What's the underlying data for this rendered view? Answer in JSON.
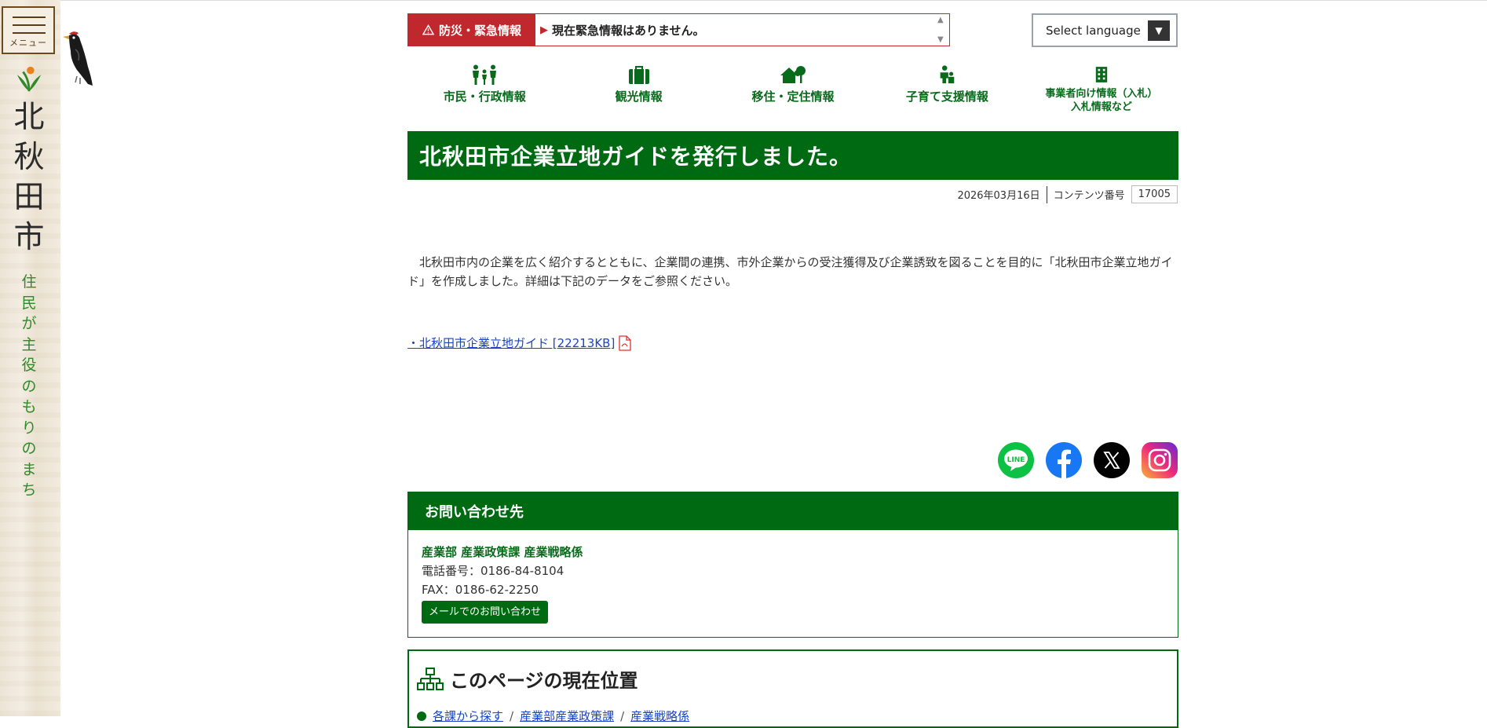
{
  "sidebar": {
    "menu_label": "メニュー",
    "city_chars": [
      "北",
      "秋",
      "田",
      "市"
    ],
    "slogan_chars": [
      "住",
      "民",
      "が",
      "主",
      "役",
      "の",
      "も",
      "り",
      "の",
      "ま",
      "ち"
    ]
  },
  "emergency": {
    "label": "防災・緊急情報",
    "message": "現在緊急情報はありません。"
  },
  "language": {
    "label": "Select language"
  },
  "nav": {
    "citizen": "市民・行政情報",
    "tourism": "観光情報",
    "migration": "移住・定住情報",
    "childcare": "子育て支援情報",
    "business_line1": "事業者向け情報（入札）",
    "business_line2": "入札情報など"
  },
  "article": {
    "title": "北秋田市企業立地ガイドを発行しました。",
    "date": "2026年03月16日",
    "content_no_label": "コンテンツ番号",
    "content_no": "17005",
    "body": "　北秋田市内の企業を広く紹介するとともに、企業間の連携、市外企業からの受注獲得及び企業誘致を図ることを目的に「北秋田市企業立地ガイド」を作成しました。詳細は下記のデータをご参照ください。",
    "pdf_link": "・北秋田市企業立地ガイド [22213KB]"
  },
  "contact": {
    "heading": "お問い合わせ先",
    "dept": "産業部 産業政策課 産業戦略係",
    "tel": "電話番号：0186-84-8104",
    "fax": "FAX：0186-62-2250",
    "mail_button": "メールでのお問い合わせ"
  },
  "location": {
    "heading": "このページの現在位置",
    "crumb1": "各課から探す",
    "crumb2": "産業部産業政策課",
    "crumb3": "産業戦略係"
  },
  "colors": {
    "brand_green": "#006a13",
    "alert_red": "#c0282d",
    "link_blue": "#1a44c8"
  }
}
